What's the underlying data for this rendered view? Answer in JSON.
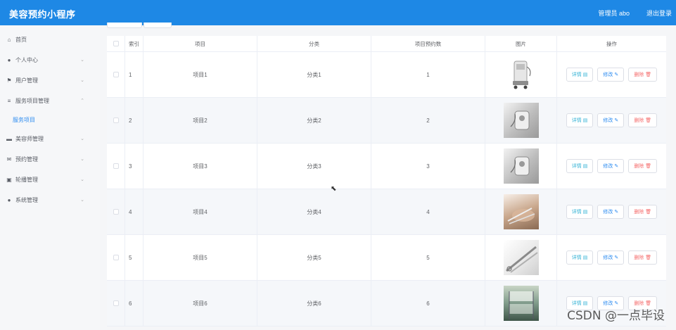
{
  "app": {
    "title": "美容预约小程序",
    "admin_label": "管理员 abo",
    "logout_label": "退出登录"
  },
  "sidebar": {
    "items": [
      {
        "label": "首页",
        "icon": "home-icon",
        "glyph": "⌂",
        "arrow": ""
      },
      {
        "label": "个人中心",
        "icon": "user-icon",
        "glyph": "●",
        "arrow": "⌄"
      },
      {
        "label": "用户管理",
        "icon": "flag-icon",
        "glyph": "⚑",
        "arrow": "⌄"
      },
      {
        "label": "服务项目管理",
        "icon": "list-icon",
        "glyph": "≡",
        "arrow": "⌃"
      },
      {
        "label": "美容师管理",
        "icon": "card-icon",
        "glyph": "▬",
        "arrow": "⌄"
      },
      {
        "label": "预约管理",
        "icon": "mail-icon",
        "glyph": "✉",
        "arrow": "⌄"
      },
      {
        "label": "轮播管理",
        "icon": "briefcase-icon",
        "glyph": "▣",
        "arrow": "⌄"
      },
      {
        "label": "系统管理",
        "icon": "user-icon",
        "glyph": "●",
        "arrow": "⌄"
      }
    ],
    "submenu": {
      "label": "服务项目"
    }
  },
  "table": {
    "headers": {
      "index": "索引",
      "name": "项目",
      "category": "分类",
      "count": "项目预约数",
      "image": "图片",
      "actions": "操作"
    },
    "actions": {
      "detail": "详情",
      "edit": "修改",
      "delete": "删除"
    },
    "rows": [
      {
        "index": "1",
        "name": "项目1",
        "category": "分类1",
        "count": "1"
      },
      {
        "index": "2",
        "name": "项目2",
        "category": "分类2",
        "count": "2"
      },
      {
        "index": "3",
        "name": "项目3",
        "category": "分类3",
        "count": "3"
      },
      {
        "index": "4",
        "name": "项目4",
        "category": "分类4",
        "count": "4"
      },
      {
        "index": "5",
        "name": "项目5",
        "category": "分类5",
        "count": "5"
      },
      {
        "index": "6",
        "name": "项目6",
        "category": "分类6",
        "count": "6"
      }
    ]
  },
  "watermark": "CSDN @一点毕设",
  "colors": {
    "topbar": "#1e88e5",
    "link": "#2d8cf0",
    "danger": "#f56c6c",
    "info": "#39b4d6"
  }
}
